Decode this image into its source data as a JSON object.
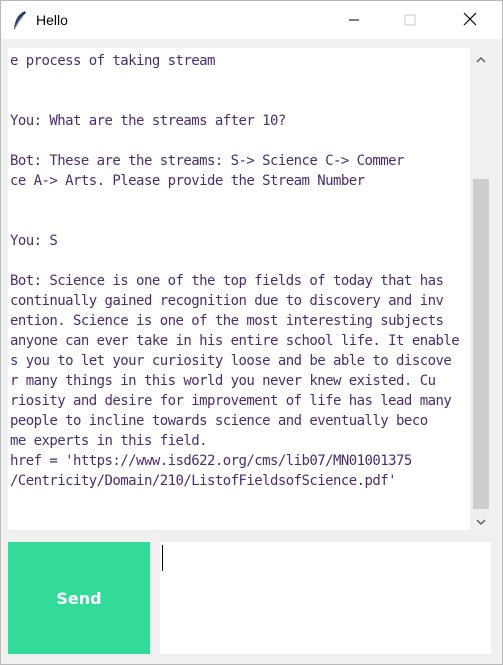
{
  "window": {
    "title": "Hello",
    "app_icon": "feather-icon",
    "controls": [
      "minimize-icon",
      "maximize-icon",
      "close-icon"
    ]
  },
  "chat": {
    "lines": [
      "e process of taking stream",
      "",
      "",
      "You: What are the streams after 10?",
      "",
      "Bot: These are the streams: S-> Science C-> Commer",
      "ce A-> Arts. Please provide the Stream Number",
      "",
      "",
      "You: S",
      "",
      "Bot: Science is one of the top fields of today that has",
      "continually gained recognition due to discovery and inv",
      "ention. Science is one of the most interesting subjects",
      "anyone can ever take in his entire school life. It enable",
      "s you to let your curiosity loose and be able to discove",
      "r many things in this world you never knew existed. Cu",
      "riosity and desire for improvement of life has lead many",
      "people to incline towards science and eventually beco",
      "me experts in this field.",
      "href = 'https://www.isd622.org/cms/lib07/MN01001375",
      "/Centricity/Domain/210/ListofFieldsofScience.pdf'"
    ]
  },
  "send_button": {
    "label": "Send"
  },
  "message_input": {
    "value": ""
  },
  "colors": {
    "send_button": "#32db9a",
    "chat_text": "#4b2d6e",
    "scroll_thumb": "#cdcdcd"
  }
}
